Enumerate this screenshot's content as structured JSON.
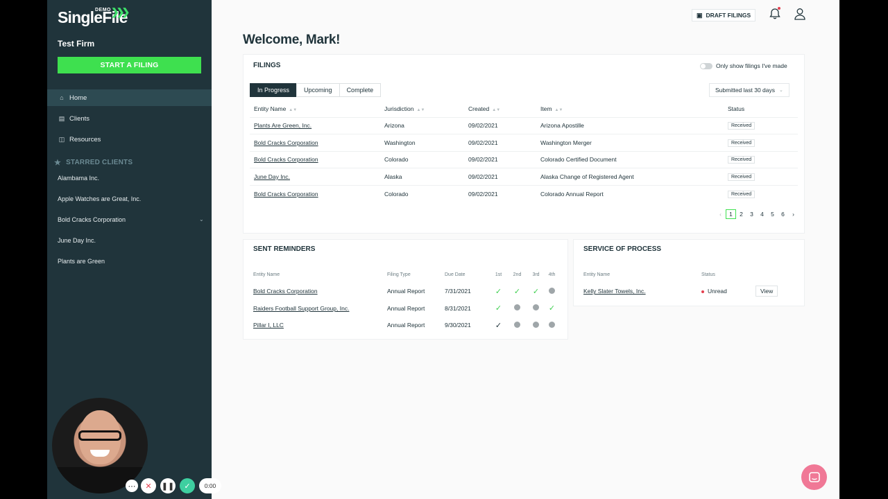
{
  "app": {
    "logo": "SingleFile",
    "demo_tag": "DEMO"
  },
  "sidebar": {
    "firm": "Test Firm",
    "start_button": "START A FILING",
    "nav": [
      {
        "label": "Home",
        "icon": "home-icon"
      },
      {
        "label": "Clients",
        "icon": "clients-icon"
      },
      {
        "label": "Resources",
        "icon": "resources-icon"
      }
    ],
    "starred_heading": "STARRED CLIENTS",
    "starred": [
      "Alambama Inc.",
      "Apple Watches are Great, Inc.",
      "Bold Cracks Corporation",
      "June Day Inc.",
      "Plants are Green"
    ]
  },
  "topbar": {
    "draft_filings": "DRAFT FILINGS"
  },
  "welcome": "Welcome, Mark!",
  "filings": {
    "title": "FILINGS",
    "toggle_label": "Only show filings I've made",
    "tabs": [
      "In Progress",
      "Upcoming",
      "Complete"
    ],
    "range": "Submitted last 30 days",
    "columns": [
      "Entity Name",
      "Jurisdiction",
      "Created",
      "Item",
      "Status"
    ],
    "rows": [
      [
        "Plants Are Green, Inc.",
        "Arizona",
        "09/02/2021",
        "Arizona Apostille",
        "Received"
      ],
      [
        "Bold Cracks Corporation",
        "Washington",
        "09/02/2021",
        "Washington Merger",
        "Received"
      ],
      [
        "Bold Cracks Corporation",
        "Colorado",
        "09/02/2021",
        "Colorado Certified Document",
        "Received"
      ],
      [
        "June Day Inc.",
        "Alaska",
        "09/02/2021",
        "Alaska Change of Registered Agent",
        "Received"
      ],
      [
        "Bold Cracks Corporation",
        "Colorado",
        "09/02/2021",
        "Colorado Annual Report",
        "Received"
      ]
    ],
    "pages": [
      "1",
      "2",
      "3",
      "4",
      "5",
      "6"
    ]
  },
  "reminders": {
    "title": "SENT REMINDERS",
    "columns": [
      "Entity Name",
      "Filing Type",
      "Due Date",
      "1st",
      "2nd",
      "3rd",
      "4th"
    ],
    "rows": [
      {
        "entity": "Bold Cracks Corporation",
        "type": "Annual Report",
        "due": "7/31/2021",
        "marks": [
          "check",
          "check",
          "check",
          "pending"
        ]
      },
      {
        "entity": "Raiders Football Support Group, Inc.",
        "type": "Annual Report",
        "due": "8/31/2021",
        "marks": [
          "check",
          "pending",
          "pending",
          "check"
        ]
      },
      {
        "entity": "Pillar I, LLC",
        "type": "Annual Report",
        "due": "9/30/2021",
        "marks": [
          "check-dark",
          "pending",
          "pending",
          "pending"
        ]
      }
    ]
  },
  "service": {
    "title": "SERVICE OF PROCESS",
    "columns": [
      "Entity Name",
      "Status"
    ],
    "rows": [
      {
        "entity": "Kelly Slater Towels, Inc.",
        "status": "Unread",
        "action": "View"
      }
    ]
  },
  "recorder": {
    "time": "0:00"
  },
  "colors": {
    "sidebar": "#20343b",
    "accent": "#3ee04f",
    "unread": "#e4404f",
    "chat": "#f07896"
  }
}
